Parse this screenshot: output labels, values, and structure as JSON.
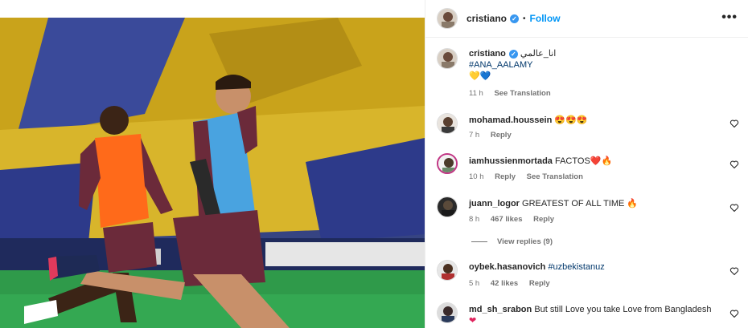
{
  "post": {
    "username": "cristiano",
    "verified_mark": "✓",
    "separator": "•",
    "follow_label": "Follow",
    "more_label": "•••"
  },
  "caption": {
    "username": "cristiano",
    "arabic": "انا_عالمي",
    "hashtag": "#ANA_AALAMY",
    "emojis": "💛💙",
    "time": "11 h",
    "translate": "See Translation"
  },
  "comments": [
    {
      "username": "mohamad.houssein",
      "text": "😍😍😍",
      "time": "7 h",
      "likes": "",
      "reply": "Reply",
      "translate": ""
    },
    {
      "username": "iamhussienmortada",
      "text": "FACTOS❤️🔥",
      "time": "10 h",
      "likes": "",
      "reply": "Reply",
      "translate": "See Translation"
    },
    {
      "username": "juann_logor",
      "text": "GREATEST OF ALL TIME 🔥",
      "time": "8 h",
      "likes": "467 likes",
      "reply": "Reply",
      "translate": ""
    },
    {
      "username": "oybek.hasanovich",
      "text": "#uzbekistanuz",
      "time": "5 h",
      "likes": "42 likes",
      "reply": "Reply",
      "translate": ""
    },
    {
      "username": "md_sh_srabon",
      "text": "But still Love you take Love from Bangladesh",
      "time": "",
      "likes": "",
      "reply": "",
      "translate": ""
    }
  ],
  "view_replies": "View replies (9)",
  "icons": {
    "verified": "verified-badge-icon",
    "more": "more-options-icon",
    "heart": "heart-outline-icon"
  },
  "colors": {
    "accent": "#0095f6",
    "hashtag": "#00376b",
    "meta_text": "#737373"
  }
}
